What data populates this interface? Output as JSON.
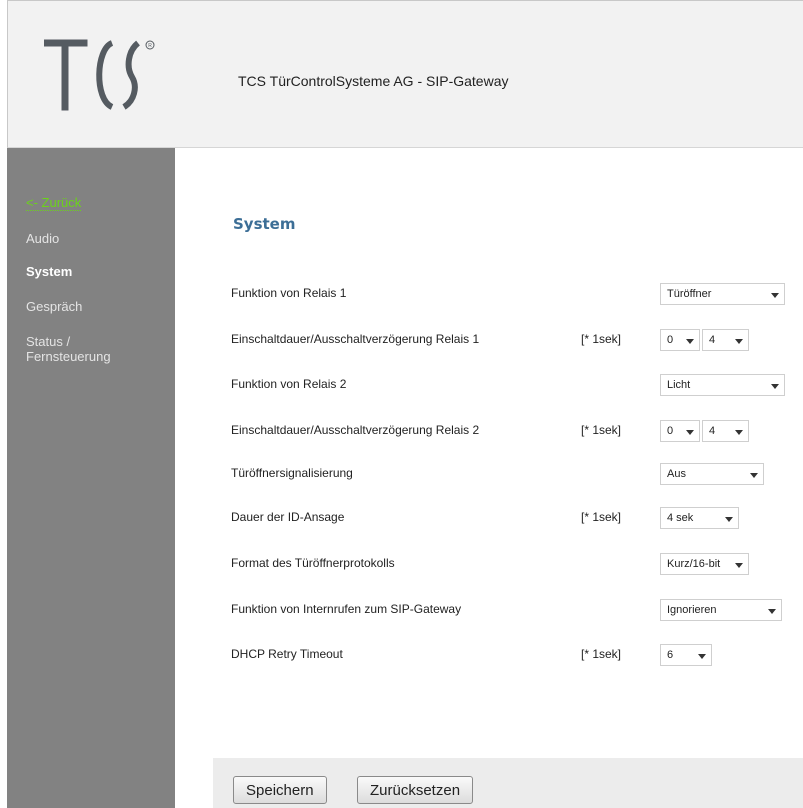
{
  "header": {
    "logo_text": "TCS",
    "title": "TCS TürControlSysteme AG - SIP-Gateway"
  },
  "sidebar": {
    "items": [
      {
        "label": "<- Zurück"
      },
      {
        "label": "Audio"
      },
      {
        "label": "System"
      },
      {
        "label": "Gespräch"
      },
      {
        "label": "Status /"
      },
      {
        "label": "Fernsteuerung"
      }
    ]
  },
  "main": {
    "title": "System",
    "rows": [
      {
        "label": "Funktion von Relais 1",
        "unit": "",
        "selects": [
          "Türöffner"
        ]
      },
      {
        "label": "Einschaltdauer/Ausschaltverzögerung Relais 1",
        "unit": "[* 1sek]",
        "selects": [
          "0",
          "4"
        ]
      },
      {
        "label": "Funktion von Relais 2",
        "unit": "",
        "selects": [
          "Licht"
        ]
      },
      {
        "label": "Einschaltdauer/Ausschaltverzögerung Relais 2",
        "unit": "[* 1sek]",
        "selects": [
          "0",
          "4"
        ]
      },
      {
        "label": "Türöffnersignalisierung",
        "unit": "",
        "selects": [
          "Aus"
        ]
      },
      {
        "label": "Dauer der ID-Ansage",
        "unit": "[* 1sek]",
        "selects": [
          "4 sek"
        ]
      },
      {
        "label": "Format des Türöffnerprotokolls",
        "unit": "",
        "selects": [
          "Kurz/16-bit"
        ]
      },
      {
        "label": "Funktion von Internrufen zum SIP-Gateway",
        "unit": "",
        "selects": [
          "Ignorieren"
        ]
      },
      {
        "label": "DHCP Retry Timeout",
        "unit": "[* 1sek]",
        "selects": [
          "6"
        ]
      }
    ]
  },
  "footer": {
    "save_label": "Speichern",
    "reset_label": "Zurücksetzen"
  },
  "colors": {
    "header_bg": "#f2f2f2",
    "sidebar_bg": "#828282",
    "back_link": "#6cd21c",
    "title": "#3c6e96",
    "footer_bg": "#ececec"
  }
}
